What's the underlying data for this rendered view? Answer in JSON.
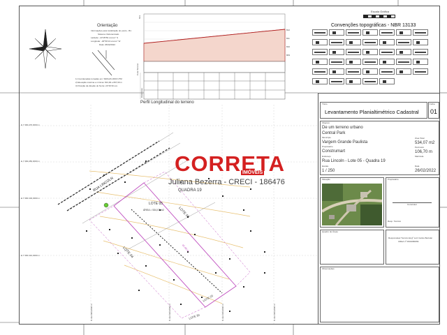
{
  "orientation": {
    "title": "Orientação",
    "notes": [
      "Informações para localização do ponto - B1",
      "Sistema: Referenciado",
      "Latitude: -23°25'56.xxxxxx'' S",
      "Longitude: -46°59'13.xxxxxx'' W",
      "Data: 26/02/2022"
    ],
    "footnotes": [
      "1) Coordenadas tomadas em: SIRGAS 2000 UTM",
      "2) Elevação máxima e mínima: 813,00 e 807,00 m",
      "3) Posição da direção do Norte: 22°46'16.xxx"
    ]
  },
  "profile": {
    "title": "Perfil Longitudinal do terreno",
    "row_labels": [
      "Cota Terreno",
      "Cota Projeto",
      "Distâncias"
    ],
    "elevations": [
      "813",
      "812",
      "811",
      "810",
      "809",
      "808",
      "807"
    ]
  },
  "scale_graph_label": "Escala Gráfica",
  "conventions_title": "Convenções topográficas - NBR 13133",
  "grid_labels": [
    "E 7.390.470,0000 m",
    "E 7.390.450,0000 m",
    "E 7.390.430,0000 m",
    "E 7.390.410,0000 m"
  ],
  "bottom_grid_labels": [
    "N 322.000,0000 m",
    "N 322.020,0000 m",
    "N 322.040,0000 m",
    "N 322.060,0000 m"
  ],
  "map_labels": {
    "street": "RUA LINCOLN",
    "quadra": "QUADRA 19",
    "lote05": "LOTE 05",
    "area": "ÁREA = 534,07 m2",
    "lote04": "LOTE 04",
    "lote06": "LOTE 06",
    "lote29": "LOTE 29",
    "lote30": "LOTE 30",
    "dimension": "42,48 m"
  },
  "watermark": {
    "brand": "CORRETA",
    "sub": "IMÓVEIS",
    "agent": "Juliana Bezerra - CRECI - 186476"
  },
  "title_block": {
    "project_label": "Título",
    "project": "Levantamento Planialtimétrico Cadastral",
    "sheet_label": "Folha",
    "sheet": "01",
    "objective_label": "Objetivo",
    "objective": "De um terreno urbano",
    "place": "Central Park",
    "city_label": "Município",
    "city": "Vargem Grande Paulista",
    "area_label": "Área Total",
    "area": "534,07 m2",
    "owner_label": "Proprietário",
    "owner": "Construmart",
    "perimeter_label": "Perímetro",
    "perimeter": "106,70 m",
    "matricula_label": "Matrícula",
    "address_label": "Endereço",
    "address": "Rua Lincoln - Lote 05 - Quadra 19",
    "scale_label": "Escala",
    "scale": "1 / 250",
    "date_label": "Data",
    "date": "26/02/2022",
    "location_label": "Situação",
    "owners_sign_label": "Proprietário",
    "contractor_label": "Construtor",
    "tech_label": "Resp. Técnico",
    "areas_label": "Quadro de Áreas",
    "tech_name": "Responsável Técnico Engº Luiz Carlos Bertolai",
    "tech_crea": "CREA nº 0601080069",
    "notes_label": "Observações"
  },
  "colors": {
    "parcel": "#c050c0",
    "profile_fill": "#f4d6cc",
    "profile_line": "#b02020",
    "brand_red": "#d42020",
    "brand_dark": "#333333",
    "contour": "#e8c070"
  }
}
